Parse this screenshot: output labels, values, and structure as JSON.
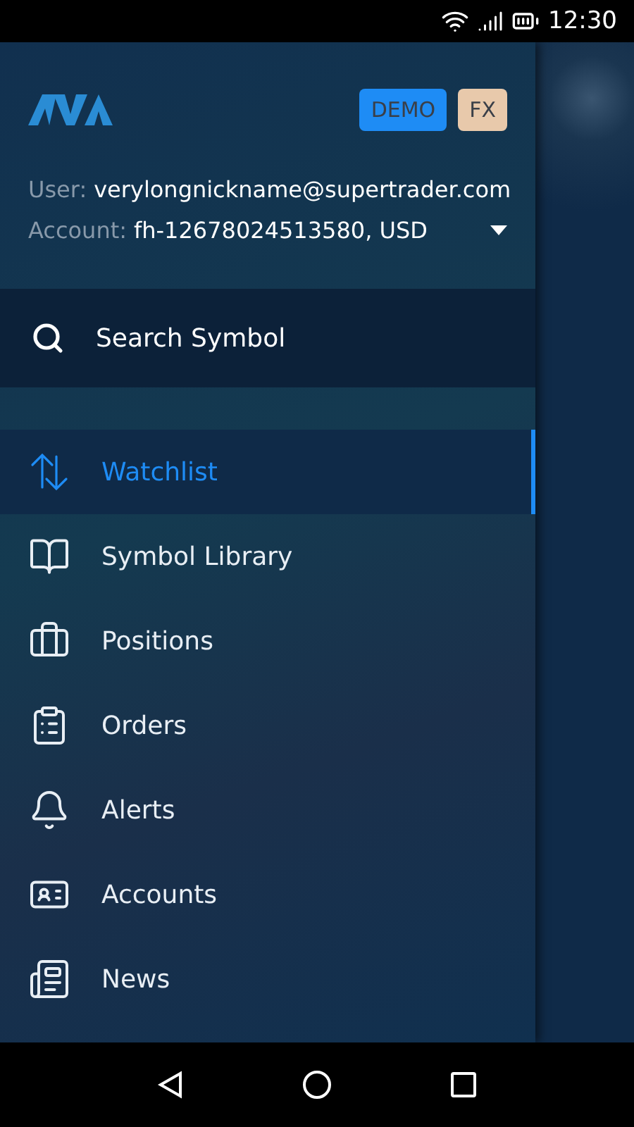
{
  "status_bar": {
    "time": "12:30"
  },
  "header": {
    "badges": [
      {
        "label": "DEMO",
        "color": "#1e8cf5"
      },
      {
        "label": "FX",
        "color": "#e8c9ab"
      }
    ],
    "user": {
      "label": "User:",
      "value": "verylongnickname@supertrader.com"
    },
    "account": {
      "label": "Account:",
      "value": "fh-12678024513580, USD"
    }
  },
  "search": {
    "placeholder": "Search Symbol"
  },
  "menu": [
    {
      "label": "Watchlist",
      "selected": true
    },
    {
      "label": "Symbol Library",
      "selected": false
    },
    {
      "label": "Positions",
      "selected": false
    },
    {
      "label": "Orders",
      "selected": false
    },
    {
      "label": "Alerts",
      "selected": false
    },
    {
      "label": "Accounts",
      "selected": false
    },
    {
      "label": "News",
      "selected": false
    }
  ]
}
